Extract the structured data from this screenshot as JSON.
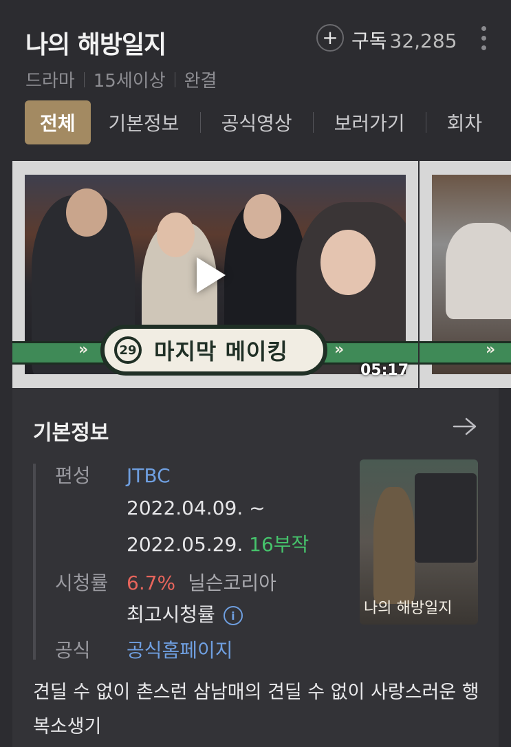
{
  "header": {
    "title": "나의 해방일지",
    "subscribe_label": "구독",
    "subscribe_count": "32,285"
  },
  "meta": [
    "드라마",
    "15세이상",
    "완결"
  ],
  "tabs": [
    {
      "label": "전체",
      "active": true
    },
    {
      "label": "기본정보",
      "active": false
    },
    {
      "label": "공식영상",
      "active": false
    },
    {
      "label": "보러가기",
      "active": false
    },
    {
      "label": "회차",
      "active": false
    }
  ],
  "videos": [
    {
      "episode": "29",
      "title": "마지막 메이킹",
      "duration": "05:17",
      "arrows": "»"
    }
  ],
  "info": {
    "section_title": "기본정보",
    "network_label": "편성",
    "network": "JTBC",
    "date_start": "2022.04.09. ~",
    "date_end": "2022.05.29.",
    "episodes": "16부작",
    "rating_label": "시청률",
    "rating": "6.7%",
    "rating_source": "닐슨코리아",
    "rating_peak": "최고시청률",
    "official_label": "공식",
    "official_link": "공식홈페이지",
    "poster_title": "나의 해방일지",
    "description": "견딜 수 없이 촌스런 삼남매의 견딜 수 없이 사랑스러운 행복소생기"
  },
  "colors": {
    "background": "#2c2c30",
    "accent_tab": "#a38a62",
    "link": "#6f9fe0",
    "rating": "#e8655c",
    "episodes": "#46c46c"
  }
}
